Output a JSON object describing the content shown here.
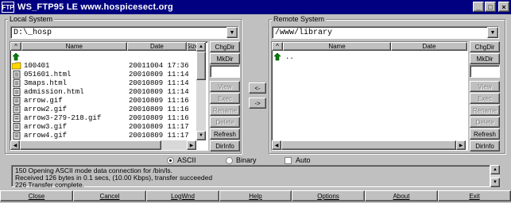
{
  "window": {
    "app_icon": "FTP",
    "title": "WS_FTP95 LE www.hospicesect.org",
    "controls": [
      "_",
      "□",
      "×"
    ]
  },
  "local": {
    "label": "Local System",
    "path": "D:\\_hosp",
    "columns": [
      "^",
      "Name",
      "Date",
      "Size"
    ],
    "files": [
      {
        "icon": "up-arrow-icon",
        "name": "",
        "date": ""
      },
      {
        "icon": "folder-icon",
        "name": "100401",
        "date": "20011004 17:36"
      },
      {
        "icon": "html-file-icon",
        "name": "051601.html",
        "date": "20010809 11:14"
      },
      {
        "icon": "html-file-icon",
        "name": "3maps.html",
        "date": "20010809 11:14"
      },
      {
        "icon": "html-file-icon",
        "name": "admission.html",
        "date": "20010809 11:14"
      },
      {
        "icon": "image-file-icon",
        "name": "arrow.gif",
        "date": "20010809 11:16"
      },
      {
        "icon": "image-file-icon",
        "name": "arrow2.gif",
        "date": "20010809 11:16"
      },
      {
        "icon": "image-file-icon",
        "name": "arrow3-279-218.gif",
        "date": "20010809 11:16"
      },
      {
        "icon": "image-file-icon",
        "name": "arrow3.gif",
        "date": "20010809 11:17"
      },
      {
        "icon": "image-file-icon",
        "name": "arrow4.gif",
        "date": "20010809 11:17"
      }
    ],
    "buttons": {
      "chgdir": "ChgDir",
      "mkdir": "MkDir",
      "view": "View",
      "exec": "Exec",
      "rename": "Rename",
      "delete": "Delete",
      "refresh": "Refresh",
      "dirinfo": "DirInfo"
    }
  },
  "remote": {
    "label": "Remote System",
    "path": "/www/library",
    "columns": [
      "^",
      "Name",
      "Date"
    ],
    "files": [
      {
        "icon": "up-arrow-icon",
        "name": "..",
        "date": ""
      }
    ],
    "buttons": {
      "chgdir": "ChgDir",
      "mkdir": "MkDir",
      "view": "View",
      "exec": "Exec",
      "rename": "Rename",
      "delete": "Delete",
      "refresh": "Refresh",
      "dirinfo": "DirInfo"
    }
  },
  "transfer": {
    "to_local": "<-",
    "to_remote": "->"
  },
  "mode": {
    "ascii": "ASCII",
    "binary": "Binary",
    "selected": "ASCII",
    "auto": "Auto",
    "auto_checked": false
  },
  "log": [
    "150 Opening ASCII mode data connection for /bin/ls.",
    "Received 126 bytes in 0.1 secs, (10.00 Kbps), transfer succeeded",
    "226 Transfer complete."
  ],
  "bottom": {
    "close": "Close",
    "cancel": "Cancel",
    "logwnd": "LogWnd",
    "help": "Help",
    "options": "Options",
    "about": "About",
    "exit": "Exit"
  }
}
